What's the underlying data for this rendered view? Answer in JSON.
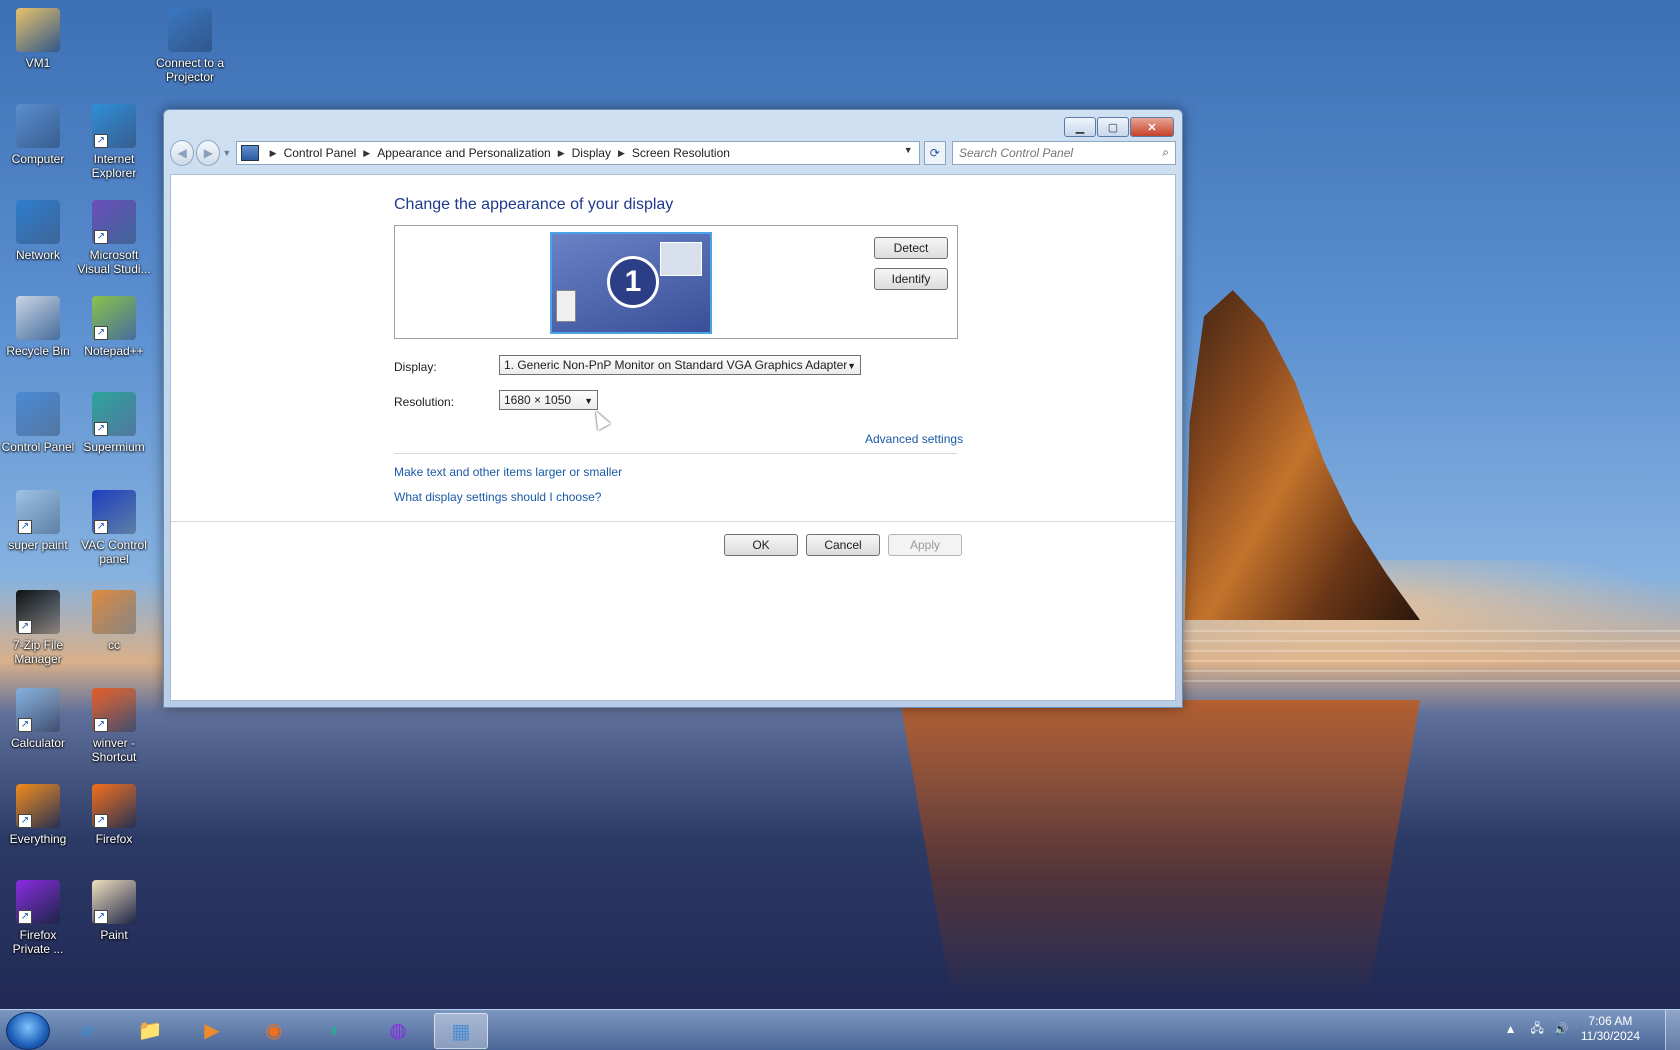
{
  "desktop": {
    "icons": [
      {
        "label": "VM1",
        "icon": "folder-icon"
      },
      {
        "label": "Connect to a Projector",
        "icon": "projector-icon"
      },
      {
        "label": "Computer",
        "icon": "computer-icon"
      },
      {
        "label": "Internet Explorer",
        "icon": "internet-explorer-icon"
      },
      {
        "label": "Network",
        "icon": "network-icon"
      },
      {
        "label": "Microsoft Visual Studi...",
        "icon": "visual-studio-icon"
      },
      {
        "label": "Recycle Bin",
        "icon": "recycle-bin-icon"
      },
      {
        "label": "Notepad++",
        "icon": "notepad-plus-plus-icon"
      },
      {
        "label": "Control Panel",
        "icon": "control-panel-icon"
      },
      {
        "label": "Supermium",
        "icon": "supermium-icon"
      },
      {
        "label": "super paint",
        "icon": "super-paint-icon"
      },
      {
        "label": "VAC Control panel",
        "icon": "vac-control-panel-icon"
      },
      {
        "label": "7-Zip File Manager",
        "icon": "seven-zip-icon"
      },
      {
        "label": "cc",
        "icon": "cc-icon"
      },
      {
        "label": "Calculator",
        "icon": "calculator-icon"
      },
      {
        "label": "winver - Shortcut",
        "icon": "windows-logo-icon"
      },
      {
        "label": "Everything",
        "icon": "everything-search-icon"
      },
      {
        "label": "Firefox",
        "icon": "firefox-icon"
      },
      {
        "label": "Firefox Private ...",
        "icon": "firefox-private-icon"
      },
      {
        "label": "Paint",
        "icon": "paint-icon"
      }
    ]
  },
  "window": {
    "breadcrumb": [
      "Control Panel",
      "Appearance and Personalization",
      "Display",
      "Screen Resolution"
    ],
    "search_placeholder": "Search Control Panel",
    "heading": "Change the appearance of your display",
    "monitor_number": "1",
    "detect_label": "Detect",
    "identify_label": "Identify",
    "display_label": "Display:",
    "display_value": "1. Generic Non-PnP Monitor on Standard VGA Graphics Adapter",
    "resolution_label": "Resolution:",
    "resolution_value": "1680 × 1050",
    "advanced_settings": "Advanced settings",
    "link_text_size": "Make text and other items larger or smaller",
    "link_what_settings": "What display settings should I choose?",
    "ok_label": "OK",
    "cancel_label": "Cancel",
    "apply_label": "Apply"
  },
  "taskbar": {
    "items": [
      "start-orb-icon",
      "internet-explorer-icon",
      "file-explorer-icon",
      "media-player-icon",
      "firefox-icon",
      "supermium-icon",
      "firefox-private-icon",
      "control-panel-icon"
    ],
    "active_item": "control-panel-icon",
    "time": "7:06 AM",
    "date": "11/30/2024"
  }
}
